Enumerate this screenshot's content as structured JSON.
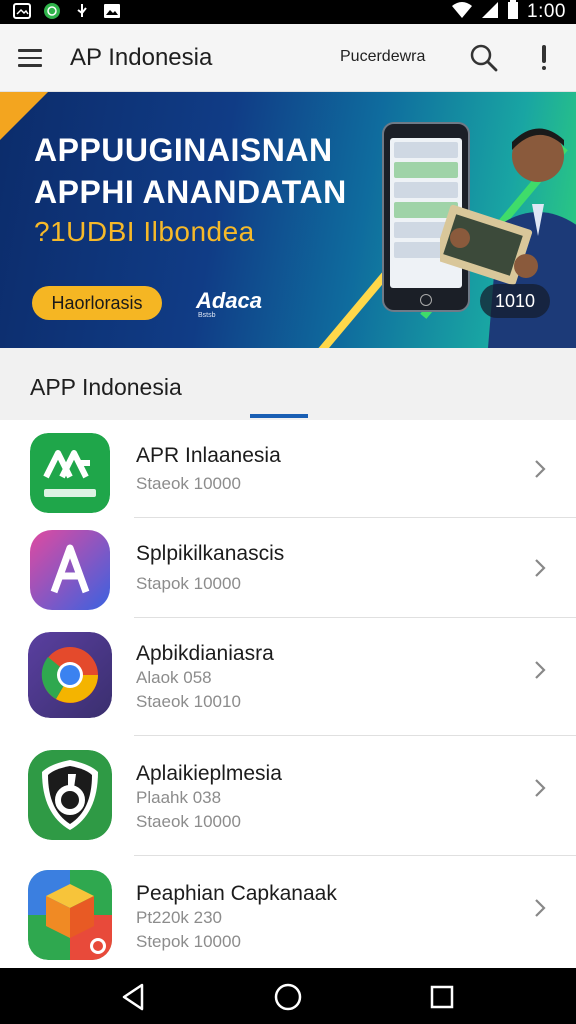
{
  "status_bar": {
    "time": "1:00",
    "icons": [
      "gallery-icon",
      "whatsapp-icon",
      "usb-icon",
      "image-icon",
      "wifi-icon",
      "signal-icon",
      "battery-icon"
    ]
  },
  "app_bar": {
    "title": "AP Indonesia",
    "action_text": "Pucerdewra",
    "icons": [
      "menu-icon",
      "search-icon",
      "more-icon"
    ]
  },
  "banner": {
    "line1": "APPUUGINAISNAN",
    "line2": "APPHI ANANDATAN",
    "line3": "?1UDBI Ilbondea",
    "cta": "Haorlorasis",
    "logo": "Adaca",
    "logo_sub": "Bstsb",
    "counter": "1010",
    "colors": {
      "accent": "#f5b623",
      "deep": "#0c2c6b",
      "green": "#2fd07a"
    }
  },
  "section": {
    "title": "APP Indonesia",
    "indicator_color": "#1a5fb4"
  },
  "items": [
    {
      "title": "APR Inlaanesia",
      "subs": [
        "Staeok 10000"
      ],
      "icon": "green-app-icon"
    },
    {
      "title": "Splpikilkanascis",
      "subs": [
        "Stapok 10000"
      ],
      "icon": "purple-a-app-icon"
    },
    {
      "title": "Apbikdianiasra",
      "subs": [
        "Alaok 058",
        "Staeok 10010"
      ],
      "icon": "chrome-like-app-icon"
    },
    {
      "title": "Aplaikieplmesia",
      "subs": [
        "Plaahk 038",
        "Staeok 10000"
      ],
      "icon": "shield-app-icon"
    },
    {
      "title": "Peaphian Capkanaak",
      "subs": [
        "Pt220k 230",
        "Stepok 10000"
      ],
      "icon": "cube-app-icon"
    }
  ],
  "nav_bar": {
    "icons": [
      "back-icon",
      "home-icon",
      "recents-icon"
    ]
  }
}
